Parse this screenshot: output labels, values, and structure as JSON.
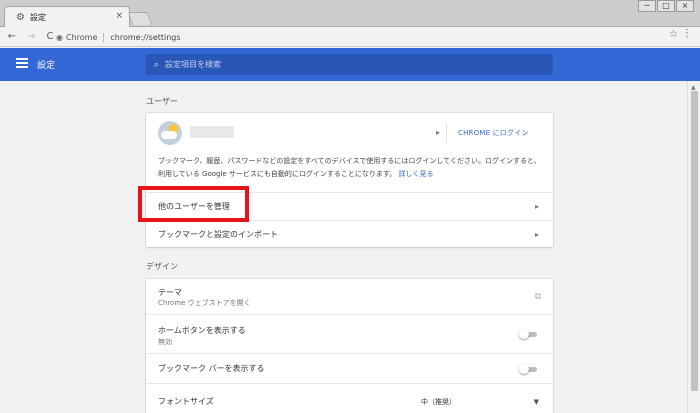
{
  "tab": {
    "title": "設定",
    "close": "×"
  },
  "window": {
    "minimize": "─",
    "maximize": "□",
    "close": "×"
  },
  "toolbar": {
    "back": "←",
    "forward": "→",
    "reload": "C",
    "chip": "Chrome",
    "url": "chrome://settings",
    "star": "☆",
    "menu": "⋮"
  },
  "header": {
    "title": "設定",
    "search_placeholder": "設定項目を検索"
  },
  "sections": {
    "user": {
      "title": "ユーザー",
      "signin": "CHROME にログイン",
      "description": "ブックマーク、履歴、パスワードなどの設定をすべてのデバイスで使用するにはログインしてください。ログインすると、利用している Google サービスにも自動的にログインすることになります。",
      "learn_more": "詳しく見る",
      "manage_people": "他のユーザーを管理",
      "import": "ブックマークと設定のインポート"
    },
    "design": {
      "title": "デザイン",
      "theme_label": "テーマ",
      "theme_sub": "Chrome ウェブストアを開く",
      "home_label": "ホームボタンを表示する",
      "home_sub": "無効",
      "bookmark_bar": "ブックマーク バーを表示する",
      "font_size": "フォントサイズ",
      "font_size_value": "中（推奨）"
    }
  },
  "icons": {
    "tab": "gear-icon",
    "search": "search-icon",
    "arrow": "chevron-right-icon",
    "external": "external-link-icon"
  },
  "colors": {
    "header": "#3367d6",
    "link": "#3367d6",
    "highlight": "#e8141a"
  }
}
